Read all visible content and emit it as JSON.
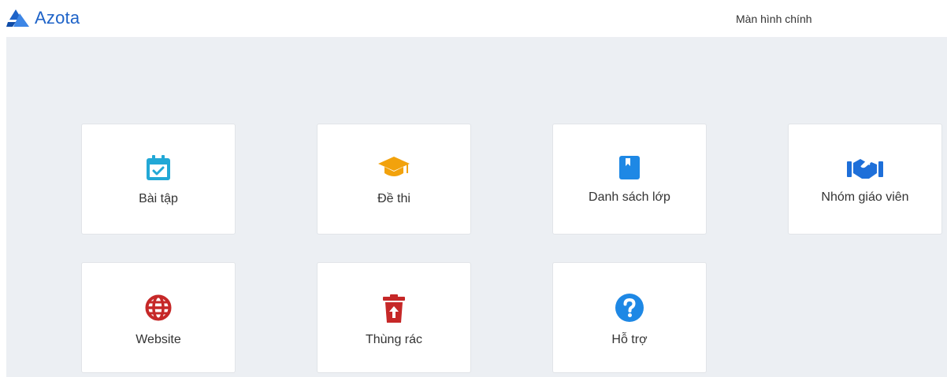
{
  "header": {
    "logo_text": "Azota",
    "right_label": "Màn hình chính"
  },
  "colors": {
    "brand": "#1e63c8",
    "background": "#eceff3",
    "assignments": "#22a8d6",
    "exams": "#f2a20c",
    "classes": "#1e88e5",
    "teachers": "#1e6fd9",
    "website": "#c62828",
    "trash": "#c62828",
    "support": "#1e88e5"
  },
  "cards": [
    {
      "label": "Bài tập",
      "icon": "calendar-check-icon"
    },
    {
      "label": "Đề thi",
      "icon": "graduation-cap-icon"
    },
    {
      "label": "Danh sách lớp",
      "icon": "book-icon"
    },
    {
      "label": "Nhóm giáo viên",
      "icon": "handshake-icon"
    },
    {
      "label": "Website",
      "icon": "globe-icon"
    },
    {
      "label": "Thùng rác",
      "icon": "trash-restore-icon"
    },
    {
      "label": "Hỗ trợ",
      "icon": "question-circle-icon"
    }
  ]
}
